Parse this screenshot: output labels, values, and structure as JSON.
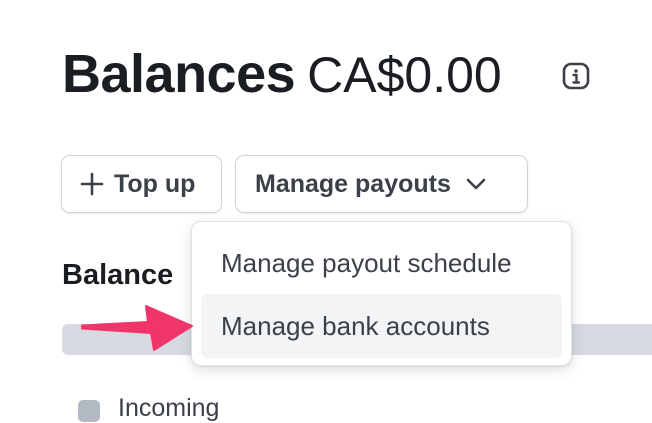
{
  "header": {
    "title": "Balances",
    "amount": "CA$0.00",
    "info_icon": "info-icon"
  },
  "actions": {
    "top_up_label": "Top up",
    "top_up_icon": "plus-icon",
    "manage_payouts_label": "Manage payouts",
    "manage_payouts_icon": "chevron-down-icon"
  },
  "dropdown": {
    "items": [
      {
        "label": "Manage payout schedule",
        "highlighted": false
      },
      {
        "label": "Manage bank accounts",
        "highlighted": true
      }
    ]
  },
  "balance_section": {
    "heading": "Balance",
    "legend": [
      {
        "label": "Incoming",
        "color": "#b3b9c2"
      }
    ]
  },
  "annotation": {
    "arrow_icon": "pointer-arrow-icon",
    "arrow_color": "#f0356b"
  }
}
